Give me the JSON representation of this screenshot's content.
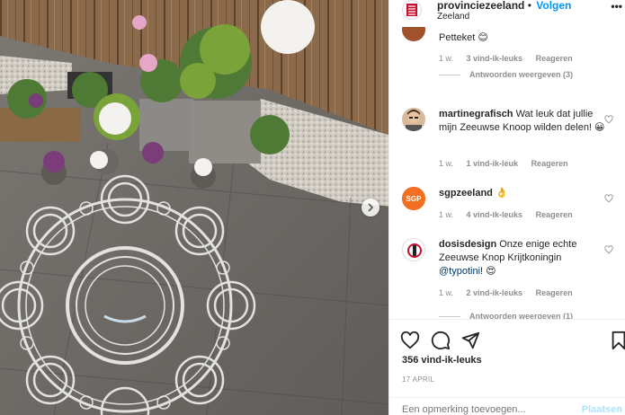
{
  "header": {
    "username": "provinciezeeland",
    "separator": "•",
    "follow_label": "Volgen",
    "location": "Zeeland",
    "more_icon": "ellipsis-icon"
  },
  "comments": [
    {
      "text": "Petteket 😊",
      "meta_time": "1 w.",
      "meta_likes": "3 vind-ik-leuks",
      "meta_reply": "Reageren",
      "view_replies": "Antwoorden weergeven (3)"
    },
    {
      "username": "martinegrafisch",
      "text": " Wat leuk dat jullie mijn Zeeuwse Knoop wilden delen! 😀",
      "meta_time": "1 w.",
      "meta_likes": "1 vind-ik-leuk",
      "meta_reply": "Reageren"
    },
    {
      "username": "sgpzeeland",
      "text": " 👌",
      "meta_time": "1 w.",
      "meta_likes": "4 vind-ik-leuks",
      "meta_reply": "Reageren"
    },
    {
      "username": "dosisdesign",
      "text": " Onze enige echte Zeeuwse Knop Krijtkoningin ",
      "mention": "@typotini",
      "text_end": "! 😍",
      "meta_time": "1 w.",
      "meta_likes": "2 vind-ik-leuks",
      "meta_reply": "Reageren",
      "view_replies_partial": "Antwoorden weergeven (1)"
    }
  ],
  "actions": {
    "like_icon": "heart-icon",
    "comment_icon": "comment-icon",
    "share_icon": "send-icon",
    "save_icon": "bookmark-icon",
    "likes": "356 vind-ik-leuks",
    "date": "17 APRIL"
  },
  "add_comment": {
    "placeholder": "Een opmerking toevoegen...",
    "post_label": "Plaatsen"
  },
  "colors": {
    "accent": "#0095f6",
    "mention": "#00376b",
    "muted": "#8e8e8e",
    "border": "#efefef"
  }
}
